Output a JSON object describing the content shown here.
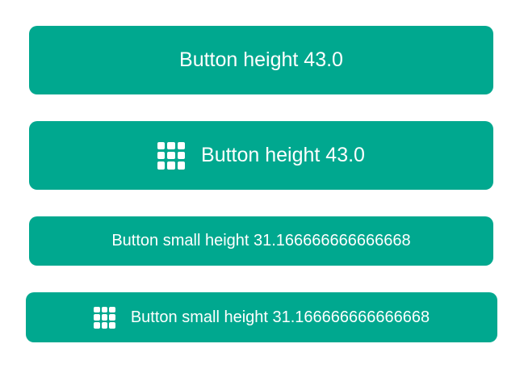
{
  "theme": {
    "button_color": "#00a88f",
    "text_color": "#ffffff"
  },
  "buttons": [
    {
      "label": "Button height 43.0",
      "icon": null
    },
    {
      "label": "Button height 43.0",
      "icon": "grid-icon"
    },
    {
      "label": "Button small height 31.166666666666668",
      "icon": null
    },
    {
      "label": "Button small height 31.166666666666668",
      "icon": "grid-icon"
    }
  ]
}
